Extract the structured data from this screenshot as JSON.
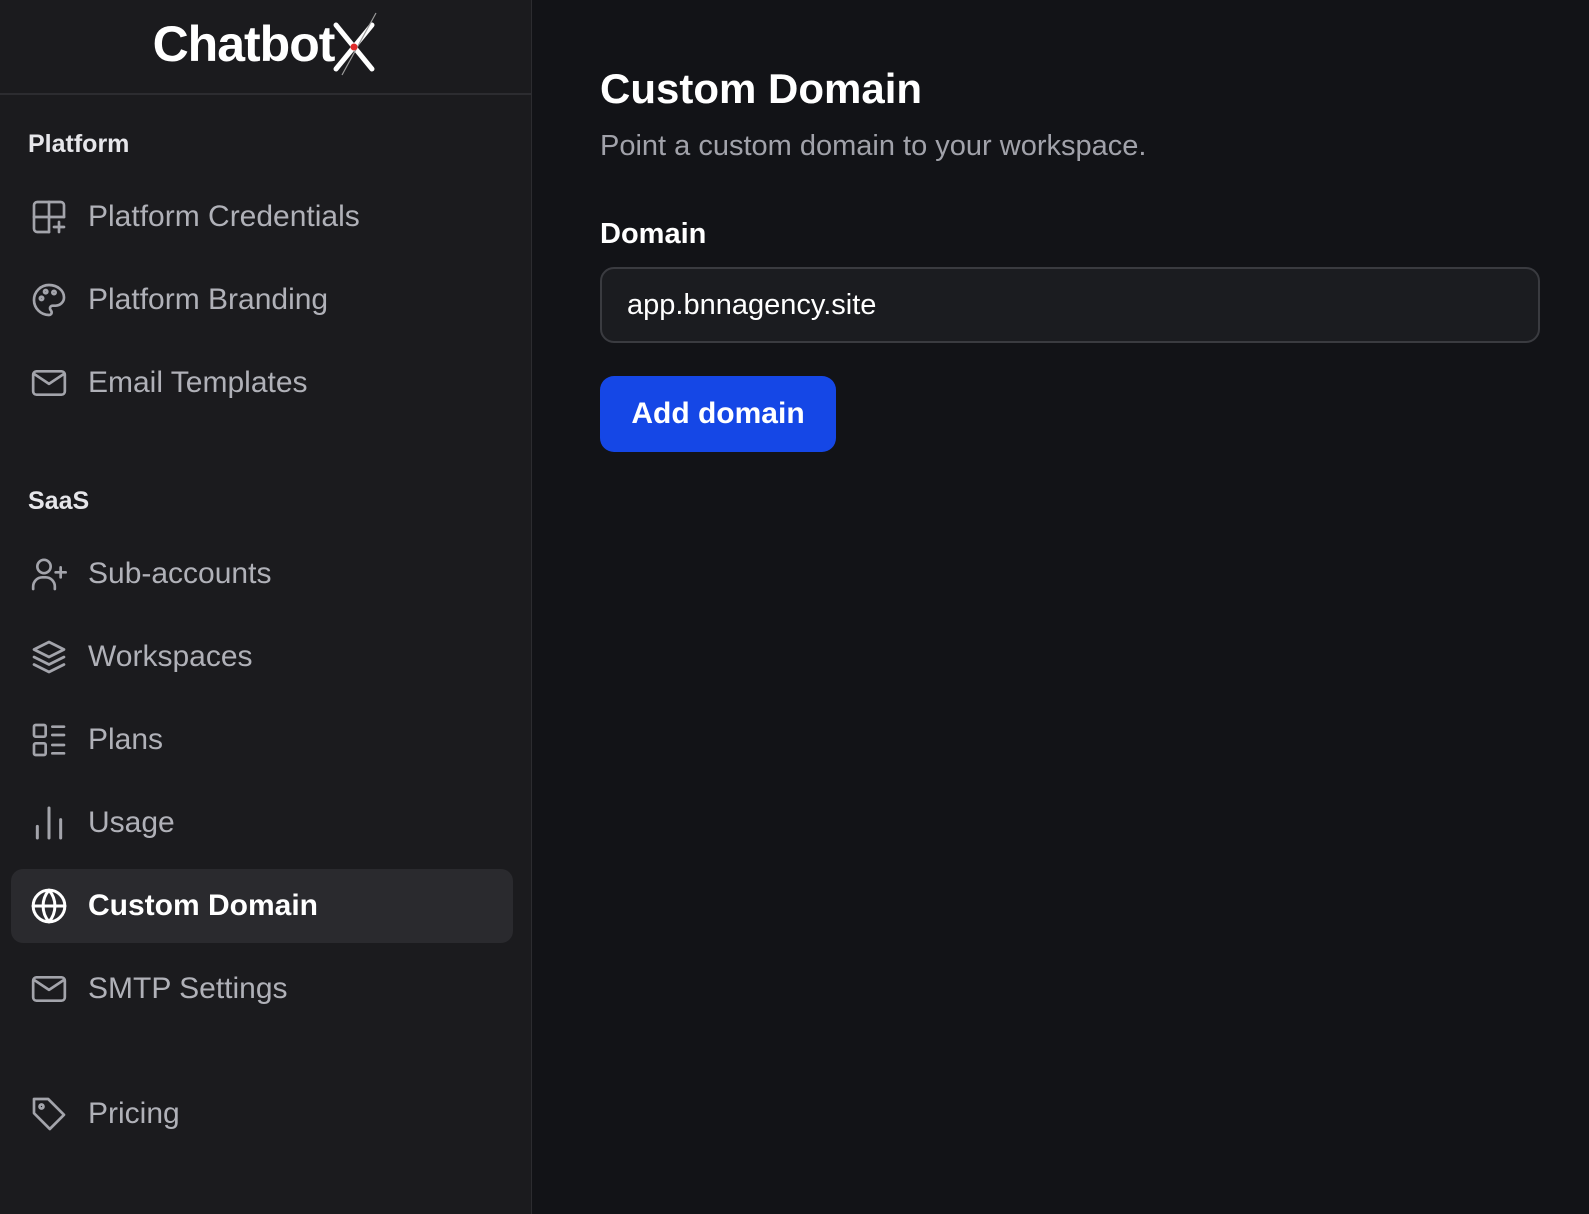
{
  "brand": {
    "name": "Chatbot",
    "mark": "X"
  },
  "sidebar": {
    "sections": [
      {
        "title": "Platform",
        "items": [
          {
            "label": "Platform Credentials",
            "icon": "grid-plus-icon"
          },
          {
            "label": "Platform Branding",
            "icon": "palette-icon"
          },
          {
            "label": "Email Templates",
            "icon": "mail-icon"
          }
        ]
      },
      {
        "title": "SaaS",
        "items": [
          {
            "label": "Sub-accounts",
            "icon": "user-plus-icon"
          },
          {
            "label": "Workspaces",
            "icon": "layers-icon"
          },
          {
            "label": "Plans",
            "icon": "list-grid-icon"
          },
          {
            "label": "Usage",
            "icon": "bar-chart-icon"
          },
          {
            "label": "Custom Domain",
            "icon": "globe-icon",
            "active": true
          },
          {
            "label": "SMTP Settings",
            "icon": "mail-icon"
          }
        ]
      }
    ],
    "footer_item": {
      "label": "Pricing",
      "icon": "tag-icon"
    }
  },
  "main": {
    "title": "Custom Domain",
    "subtitle": "Point a custom domain to your workspace.",
    "domain_field": {
      "label": "Domain",
      "value": "app.bnnagency.site"
    },
    "add_button_label": "Add domain"
  },
  "colors": {
    "accent": "#1547e6",
    "sidebar_bg": "#1b1b1e",
    "main_bg": "#121317",
    "active_item_bg": "#2a2a2e"
  }
}
